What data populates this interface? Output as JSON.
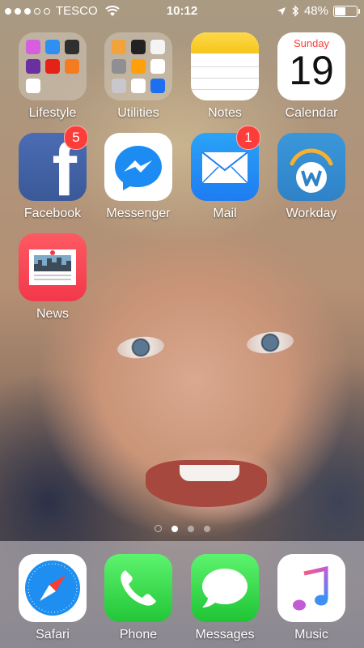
{
  "status_bar": {
    "carrier": "TESCO",
    "time": "10:12",
    "battery_percent": "48%",
    "battery_level": 0.48,
    "signal_bars": 3,
    "signal_total": 5
  },
  "apps": [
    {
      "name": "Lifestyle",
      "type": "folder"
    },
    {
      "name": "Utilities",
      "type": "folder"
    },
    {
      "name": "Notes",
      "type": "app"
    },
    {
      "name": "Calendar",
      "type": "app",
      "weekday": "Sunday",
      "day": "19"
    },
    {
      "name": "Facebook",
      "type": "app",
      "badge": "5"
    },
    {
      "name": "Messenger",
      "type": "app"
    },
    {
      "name": "Mail",
      "type": "app",
      "badge": "1"
    },
    {
      "name": "Workday",
      "type": "app"
    },
    {
      "name": "News",
      "type": "app"
    }
  ],
  "page_indicator": {
    "pages": 3,
    "current": 1,
    "has_search_page": true
  },
  "dock": [
    {
      "name": "Safari"
    },
    {
      "name": "Phone"
    },
    {
      "name": "Messages"
    },
    {
      "name": "Music"
    }
  ],
  "colors": {
    "badge": "#fc3d39",
    "facebook": "#3b5998",
    "mail": "#1d7cf2",
    "news": "#f2384a",
    "phone_messages": "#22c637"
  },
  "icons": {
    "lifestyle": "folder-icon",
    "utilities": "folder-icon",
    "notes": "notes-icon",
    "calendar": "calendar-icon",
    "facebook": "facebook-icon",
    "messenger": "messenger-icon",
    "mail": "mail-icon",
    "workday": "workday-icon",
    "news": "news-icon",
    "safari": "compass-icon",
    "phone": "phone-icon",
    "messages": "speech-bubble-icon",
    "music": "music-note-icon"
  }
}
